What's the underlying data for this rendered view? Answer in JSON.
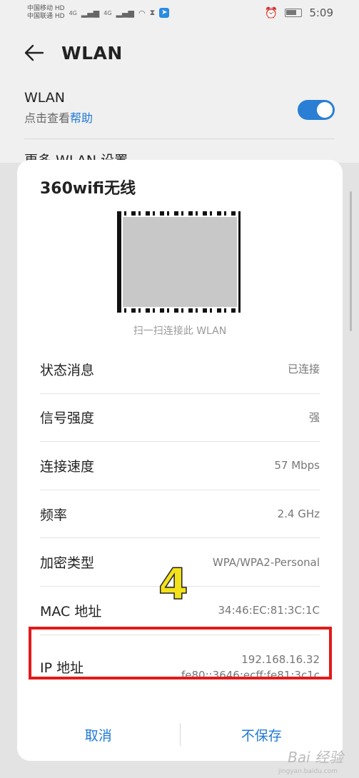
{
  "status_bar": {
    "carrier1": "中国移动",
    "carrier2": "中国联通",
    "hd1": "HD",
    "hd2": "HD",
    "net1": "4G",
    "net2": "4G",
    "time": "5:09"
  },
  "header": {
    "title": "WLAN"
  },
  "wlan": {
    "label": "WLAN",
    "sub_prefix": "点击查看",
    "help_link": "帮助",
    "enabled": true
  },
  "more_settings": "更多 WLAN 设置",
  "dialog": {
    "title": "360wifi无线",
    "qr_caption": "扫一扫连接此 WLAN",
    "rows": [
      {
        "label": "状态消息",
        "value": "已连接"
      },
      {
        "label": "信号强度",
        "value": "强"
      },
      {
        "label": "连接速度",
        "value": "57 Mbps"
      },
      {
        "label": "频率",
        "value": "2.4 GHz"
      },
      {
        "label": "加密类型",
        "value": "WPA/WPA2-Personal"
      },
      {
        "label": "MAC 地址",
        "value": "34:46:EC:81:3C:1C"
      }
    ],
    "ip": {
      "label": "IP 地址",
      "value_v4": "192.168.16.32",
      "value_v6": "fe80::3646:ecff:fe81:3c1c"
    },
    "cancel": "取消",
    "forget": "不保存"
  },
  "annotation": {
    "step": "4",
    "highlight_color": "#e21a1a"
  },
  "watermark": {
    "brand": "Bai 经验",
    "url": "jingyan.baidu.com"
  },
  "colors": {
    "accent": "#1f7ad6",
    "toggle_on": "#2a7fd4"
  }
}
